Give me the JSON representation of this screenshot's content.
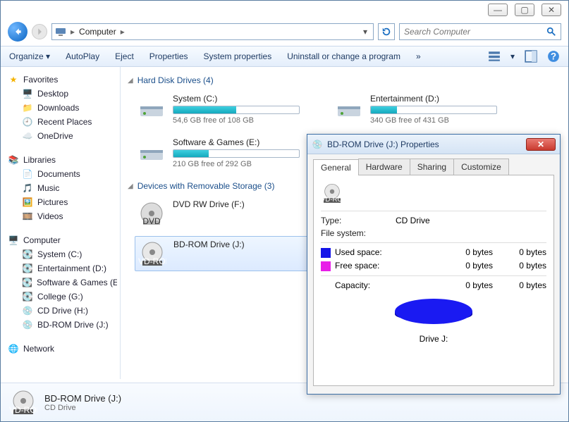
{
  "titlebar": {
    "min": "—",
    "max": "▢",
    "close": "✕"
  },
  "nav": {
    "crumb_root": "Computer",
    "search_placeholder": "Search Computer"
  },
  "toolbar": {
    "organize": "Organize",
    "autoplay": "AutoPlay",
    "eject": "Eject",
    "properties": "Properties",
    "system_properties": "System properties",
    "uninstall": "Uninstall or change a program",
    "more": "»"
  },
  "sidebar": {
    "favorites": {
      "label": "Favorites",
      "items": [
        "Desktop",
        "Downloads",
        "Recent Places",
        "OneDrive"
      ]
    },
    "libraries": {
      "label": "Libraries",
      "items": [
        "Documents",
        "Music",
        "Pictures",
        "Videos"
      ]
    },
    "computer": {
      "label": "Computer",
      "items": [
        "System (C:)",
        "Entertainment (D:)",
        "Software & Games (E:)",
        "College (G:)",
        "CD Drive (H:)",
        "BD-ROM Drive (J:)"
      ]
    },
    "network": {
      "label": "Network"
    }
  },
  "groups": {
    "hdd_label": "Hard Disk Drives (4)",
    "removable_label": "Devices with Removable Storage (3)"
  },
  "drives": {
    "c": {
      "name": "System (C:)",
      "free": "54,6 GB free of 108 GB",
      "fill_pct": 50
    },
    "d": {
      "name": "Entertainment (D:)",
      "free": "340 GB free of 431 GB",
      "fill_pct": 21
    },
    "e": {
      "name": "Software & Games (E:)",
      "free": "210 GB free of 292 GB",
      "fill_pct": 28
    },
    "f": {
      "name": "DVD RW Drive (F:)"
    },
    "j": {
      "name": "BD-ROM Drive (J:)"
    }
  },
  "details": {
    "name": "BD-ROM Drive (J:)",
    "type": "CD Drive"
  },
  "dialog": {
    "title": "BD-ROM Drive (J:) Properties",
    "tabs": [
      "General",
      "Hardware",
      "Sharing",
      "Customize"
    ],
    "type_label": "Type:",
    "type_value": "CD Drive",
    "fs_label": "File system:",
    "used_label": "Used space:",
    "used_bytes1": "0 bytes",
    "used_bytes2": "0 bytes",
    "free_label": "Free space:",
    "free_bytes1": "0 bytes",
    "free_bytes2": "0 bytes",
    "capacity_label": "Capacity:",
    "cap_bytes1": "0 bytes",
    "cap_bytes2": "0 bytes",
    "drive_letter": "Drive J:",
    "icon_label": "DVD-ROM"
  }
}
